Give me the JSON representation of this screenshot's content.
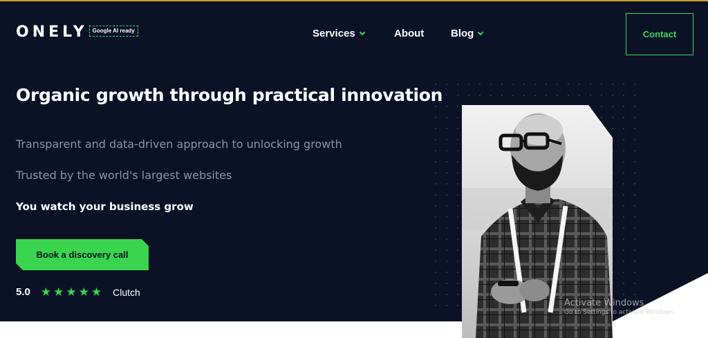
{
  "header": {
    "logo_text": "ONELY",
    "logo_badge": "Google AI ready",
    "nav": [
      {
        "label": "Services",
        "has_dropdown": true
      },
      {
        "label": "About",
        "has_dropdown": false
      },
      {
        "label": "Blog",
        "has_dropdown": true
      }
    ],
    "contact_label": "Contact"
  },
  "hero": {
    "headline": "Organic growth through practical innovation",
    "subline_1": "Transparent and data-driven approach to unlocking growth",
    "subline_2": "Trusted by the world's largest websites",
    "highlight": "You watch your business grow",
    "cta_label": "Book a discovery call",
    "rating": {
      "score": "5.0",
      "stars": 5,
      "source": "Clutch"
    },
    "photo_icon": "speaker-portrait"
  },
  "watermark": {
    "title": "Activate Windows",
    "subtitle": "Go to Settings to activate Windows."
  },
  "colors": {
    "background": "#0b1226",
    "accent": "#3ad44f",
    "muted_text": "#8b93a8",
    "top_border": "#c8a22c"
  }
}
